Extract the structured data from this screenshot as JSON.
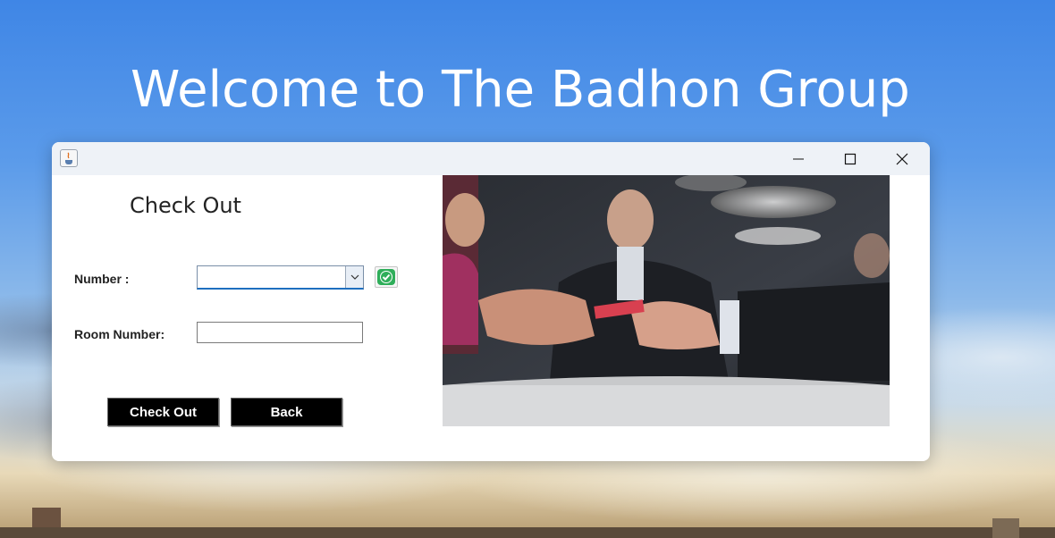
{
  "banner": {
    "title": "Welcome to The Badhon Group"
  },
  "window": {
    "icons": {
      "app": "java-app-icon",
      "minimize": "minimize-icon",
      "maximize": "maximize-icon",
      "close": "close-icon"
    }
  },
  "form": {
    "heading": "Check Out",
    "number_label": "Number :",
    "number_value": "",
    "room_label": "Room Number:",
    "room_value": "",
    "checkout_label": "Check Out",
    "back_label": "Back"
  },
  "colors": {
    "accent": "#1f6fbf",
    "check_green": "#2fae5a",
    "button_bg": "#000000"
  }
}
